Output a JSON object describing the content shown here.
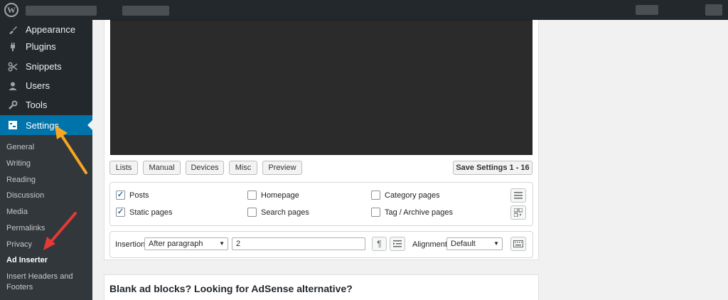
{
  "admin_bar": {
    "logo_icon": "wordpress-logo-icon"
  },
  "sidebar": {
    "items": [
      {
        "label": "Appearance",
        "icon": "paintbrush-icon"
      },
      {
        "label": "Plugins",
        "icon": "plug-icon"
      },
      {
        "label": "Snippets",
        "icon": "scissors-icon"
      },
      {
        "label": "Users",
        "icon": "user-icon"
      },
      {
        "label": "Tools",
        "icon": "wrench-icon"
      },
      {
        "label": "Settings",
        "icon": "settings-icon"
      }
    ],
    "submenu": [
      {
        "label": "General"
      },
      {
        "label": "Writing"
      },
      {
        "label": "Reading"
      },
      {
        "label": "Discussion"
      },
      {
        "label": "Media"
      },
      {
        "label": "Permalinks"
      },
      {
        "label": "Privacy"
      },
      {
        "label": "Ad Inserter"
      },
      {
        "label": "Insert Headers and Footers"
      }
    ]
  },
  "toolbar": {
    "tabs": [
      "Lists",
      "Manual",
      "Devices",
      "Misc",
      "Preview"
    ],
    "save_label": "Save Settings 1 - 16"
  },
  "checks": {
    "posts": "Posts",
    "static_pages": "Static pages",
    "homepage": "Homepage",
    "search_pages": "Search pages",
    "category_pages": "Category pages",
    "tag_archive_pages": "Tag / Archive pages"
  },
  "insertion": {
    "label": "Insertion",
    "position_value": "After paragraph",
    "paragraph_number": "2",
    "alignment_label": "Alignment",
    "alignment_value": "Default"
  },
  "promo": {
    "title": "Blank ad blocks? Looking for AdSense alternative?"
  },
  "colors": {
    "accent": "#0073aa",
    "sidebar_bg": "#23282d",
    "annotation_orange": "#f5a623",
    "annotation_red": "#e53935"
  }
}
